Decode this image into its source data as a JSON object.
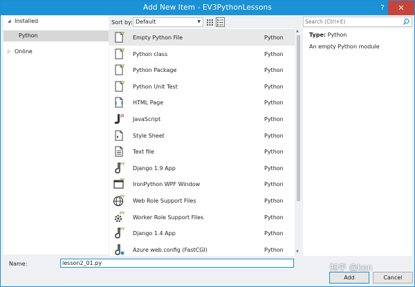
{
  "window": {
    "title": "Add New Item - EV3PythonLessons",
    "help_label": "?",
    "close_label": "✕"
  },
  "tree": {
    "items": [
      {
        "label": "Installed",
        "arrow": "◢"
      },
      {
        "label": "Python",
        "arrow": ""
      },
      {
        "label": "Online",
        "arrow": "▷"
      }
    ]
  },
  "toolbar": {
    "sort_label": "Sort by:",
    "sort_value": "Default"
  },
  "search": {
    "placeholder": "Search (Ctrl+E)"
  },
  "templates": [
    {
      "name": "Empty Python File",
      "type": "Python",
      "icon": "python-file-icon"
    },
    {
      "name": "Python class",
      "type": "Python",
      "icon": "python-file-icon"
    },
    {
      "name": "Python Package",
      "type": "Python",
      "icon": "python-file-icon"
    },
    {
      "name": "Python Unit Test",
      "type": "Python",
      "icon": "python-file-icon"
    },
    {
      "name": "HTML Page",
      "type": "Python",
      "icon": "html-page-icon"
    },
    {
      "name": "JavaScript",
      "type": "Python",
      "icon": "javascript-file-icon"
    },
    {
      "name": "Style Sheet",
      "type": "Python",
      "icon": "stylesheet-icon"
    },
    {
      "name": "Text file",
      "type": "Python",
      "icon": "text-file-icon"
    },
    {
      "name": "Django 1.9 App",
      "type": "Python",
      "icon": "django-app-icon"
    },
    {
      "name": "IronPython WPF Window",
      "type": "Python",
      "icon": "wpf-window-icon"
    },
    {
      "name": "Web Role Support Files",
      "type": "Python",
      "icon": "globe-icon"
    },
    {
      "name": "Worker Role Support Files",
      "type": "Python",
      "icon": "gear-icon"
    },
    {
      "name": "Django 1.4 App",
      "type": "Python",
      "icon": "django-app-icon"
    },
    {
      "name": "Azure web.config (FastCGI)",
      "type": "Python",
      "icon": "webconfig-icon"
    }
  ],
  "details": {
    "type_label": "Type:",
    "type_value": "Python",
    "description": "An empty Python module"
  },
  "footer": {
    "name_label": "Name:",
    "name_value": "lesson2_01.py",
    "add_label": "Add",
    "cancel_label": "Cancel"
  },
  "watermark": "知乎 @ken",
  "colors": {
    "accent": "#1b91d6",
    "close": "#c7443b",
    "python_badge": "#8dac3a"
  }
}
